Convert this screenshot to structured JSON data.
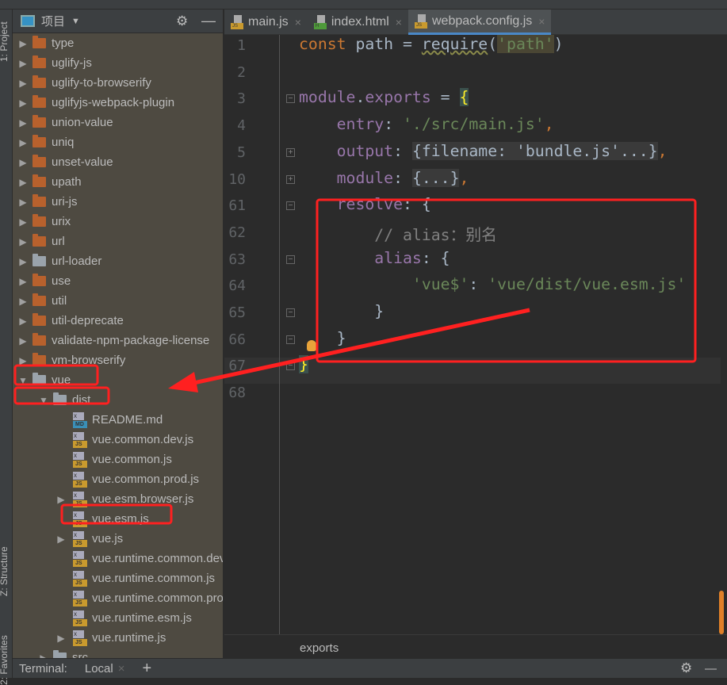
{
  "side_tabs": {
    "project": "1: Project",
    "structure": "Z: Structure",
    "favorites": "2: Favorites"
  },
  "sidebar": {
    "title": "项目",
    "tree": [
      {
        "label": "type",
        "kind": "folder",
        "color": "#b8612d",
        "level": 0,
        "expandable": true
      },
      {
        "label": "uglify-js",
        "kind": "folder",
        "color": "#b8612d",
        "level": 0,
        "expandable": true
      },
      {
        "label": "uglify-to-browserify",
        "kind": "folder",
        "color": "#b8612d",
        "level": 0,
        "expandable": true
      },
      {
        "label": "uglifyjs-webpack-plugin",
        "kind": "folder",
        "color": "#b8612d",
        "level": 0,
        "expandable": true
      },
      {
        "label": "union-value",
        "kind": "folder",
        "color": "#b8612d",
        "level": 0,
        "expandable": true
      },
      {
        "label": "uniq",
        "kind": "folder",
        "color": "#b8612d",
        "level": 0,
        "expandable": true
      },
      {
        "label": "unset-value",
        "kind": "folder",
        "color": "#b8612d",
        "level": 0,
        "expandable": true
      },
      {
        "label": "upath",
        "kind": "folder",
        "color": "#b8612d",
        "level": 0,
        "expandable": true
      },
      {
        "label": "uri-js",
        "kind": "folder",
        "color": "#b8612d",
        "level": 0,
        "expandable": true
      },
      {
        "label": "urix",
        "kind": "folder",
        "color": "#b8612d",
        "level": 0,
        "expandable": true
      },
      {
        "label": "url",
        "kind": "folder",
        "color": "#b8612d",
        "level": 0,
        "expandable": true
      },
      {
        "label": "url-loader",
        "kind": "folder",
        "color": "#9aa3ab",
        "level": 0,
        "expandable": true
      },
      {
        "label": "use",
        "kind": "folder",
        "color": "#b8612d",
        "level": 0,
        "expandable": true
      },
      {
        "label": "util",
        "kind": "folder",
        "color": "#b8612d",
        "level": 0,
        "expandable": true
      },
      {
        "label": "util-deprecate",
        "kind": "folder",
        "color": "#b8612d",
        "level": 0,
        "expandable": true
      },
      {
        "label": "validate-npm-package-license",
        "kind": "folder",
        "color": "#b8612d",
        "level": 0,
        "expandable": true
      },
      {
        "label": "vm-browserify",
        "kind": "folder",
        "color": "#b8612d",
        "level": 0,
        "expandable": true
      },
      {
        "label": "vue",
        "kind": "folder",
        "color": "#9aa3ab",
        "level": 0,
        "expandable": true,
        "expanded": true
      },
      {
        "label": "dist",
        "kind": "folder",
        "color": "#9aa3ab",
        "level": 1,
        "expandable": true,
        "expanded": true
      },
      {
        "label": "README.md",
        "kind": "file",
        "tag": "MD",
        "level": 2
      },
      {
        "label": "vue.common.dev.js",
        "kind": "file",
        "tag": "JS",
        "level": 2
      },
      {
        "label": "vue.common.js",
        "kind": "file",
        "tag": "JS",
        "level": 2
      },
      {
        "label": "vue.common.prod.js",
        "kind": "file",
        "tag": "JS",
        "level": 2
      },
      {
        "label": "vue.esm.browser.js",
        "kind": "file",
        "tag": "JS",
        "level": 2,
        "expandable": true
      },
      {
        "label": "vue.esm.js",
        "kind": "file",
        "tag": "JS",
        "level": 2
      },
      {
        "label": "vue.js",
        "kind": "file",
        "tag": "JS",
        "level": 2,
        "expandable": true
      },
      {
        "label": "vue.runtime.common.dev.js",
        "kind": "file",
        "tag": "JS",
        "level": 2
      },
      {
        "label": "vue.runtime.common.js",
        "kind": "file",
        "tag": "JS",
        "level": 2
      },
      {
        "label": "vue.runtime.common.prod.js",
        "kind": "file",
        "tag": "JS",
        "level": 2
      },
      {
        "label": "vue.runtime.esm.js",
        "kind": "file",
        "tag": "JS",
        "level": 2
      },
      {
        "label": "vue.runtime.js",
        "kind": "file",
        "tag": "JS",
        "level": 2,
        "expandable": true
      },
      {
        "label": "src",
        "kind": "folder",
        "color": "#9aa3ab",
        "level": 1,
        "expandable": true
      }
    ]
  },
  "tabs": [
    {
      "label": "main.js",
      "tag": "JS",
      "color": "#c99a2e"
    },
    {
      "label": "index.html",
      "tag": "H",
      "color": "#4e9a3a"
    },
    {
      "label": "webpack.config.js",
      "tag": "JS",
      "color": "#c99a2e",
      "active": true
    }
  ],
  "code": [
    {
      "n": "1",
      "html": "<span class='kw'>const</span> path = <span style='text-decoration:underline wavy #8a8a4a'>require</span>(<span class='str' style='background:#4a4634'>'path'</span>)"
    },
    {
      "n": "2",
      "html": ""
    },
    {
      "n": "3",
      "html": "<span class='prop'>module</span>.<span class='prop'>exports</span> = <span class='br'>{</span>",
      "fold": "-"
    },
    {
      "n": "4",
      "html": "    <span class='prop'>entry</span>: <span class='str'>'./src/main.js'</span><span class='kw'>,</span>"
    },
    {
      "n": "5",
      "html": "    <span class='prop'>output</span>: <span class='fold'>{filename: 'bundle.js'...}</span><span class='kw'>,</span>",
      "fold": "+"
    },
    {
      "n": "10",
      "html": "    <span class='prop'>module</span>: <span class='fold'>{...}</span><span class='kw'>,</span>",
      "fold": "+"
    },
    {
      "n": "61",
      "html": "    <span class='prop'>resolve</span>: {",
      "fold": "-"
    },
    {
      "n": "62",
      "html": "        <span class='cm'>// alias：别名</span>"
    },
    {
      "n": "63",
      "html": "        <span class='prop'>alias</span>: {",
      "fold": "-"
    },
    {
      "n": "64",
      "html": "            <span class='str'>'vue$'</span>: <span class='str'>'vue/dist/vue.esm.js'</span>"
    },
    {
      "n": "65",
      "html": "        }",
      "fold": "-"
    },
    {
      "n": "66",
      "html": "    }",
      "fold": "-"
    },
    {
      "n": "67",
      "html": "<span class='br'>}</span>",
      "fold": "-"
    },
    {
      "n": "68",
      "html": ""
    }
  ],
  "breadcrumb": "exports",
  "terminal": {
    "label": "Terminal:",
    "tab": "Local",
    "add": "+"
  },
  "annotation_color": "#ff2020"
}
